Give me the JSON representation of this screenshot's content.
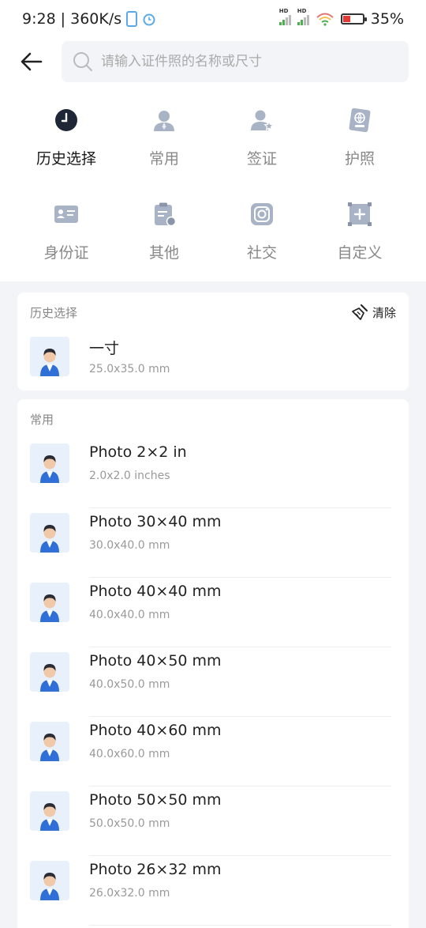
{
  "status": {
    "time": "9:28",
    "speed": "| 360K/s",
    "battery": "35%",
    "battery_level": 0.35,
    "sim1": "HD",
    "sim2": "HD"
  },
  "search": {
    "placeholder": "请输入证件照的名称或尺寸"
  },
  "categories": [
    {
      "label": "历史选择",
      "icon": "clock-icon"
    },
    {
      "label": "常用",
      "icon": "person-icon"
    },
    {
      "label": "签证",
      "icon": "visa-person-icon"
    },
    {
      "label": "护照",
      "icon": "passport-icon"
    },
    {
      "label": "身份证",
      "icon": "id-card-icon"
    },
    {
      "label": "其他",
      "icon": "clipboard-icon"
    },
    {
      "label": "社交",
      "icon": "instagram-icon"
    },
    {
      "label": "自定义",
      "icon": "custom-frame-icon"
    }
  ],
  "history": {
    "title": "历史选择",
    "clear_label": "清除",
    "items": [
      {
        "title": "一寸",
        "size": "25.0x35.0 mm"
      }
    ]
  },
  "common": {
    "title": "常用",
    "items": [
      {
        "title": "Photo 2×2 in",
        "size": "2.0x2.0 inches"
      },
      {
        "title": "Photo 30×40 mm",
        "size": "30.0x40.0 mm"
      },
      {
        "title": "Photo 40×40 mm",
        "size": "40.0x40.0 mm"
      },
      {
        "title": "Photo 40×50 mm",
        "size": "40.0x50.0 mm"
      },
      {
        "title": "Photo 40×60 mm",
        "size": "40.0x60.0 mm"
      },
      {
        "title": "Photo 50×50 mm",
        "size": "50.0x50.0 mm"
      },
      {
        "title": "Photo 26×32 mm",
        "size": "26.0x32.0 mm"
      }
    ]
  },
  "colors": {
    "icon_gray": "#a9b3c6",
    "icon_active": "#1f2635",
    "avatar_bg": "#e8f0fb",
    "suit_blue": "#2f6fd6"
  }
}
